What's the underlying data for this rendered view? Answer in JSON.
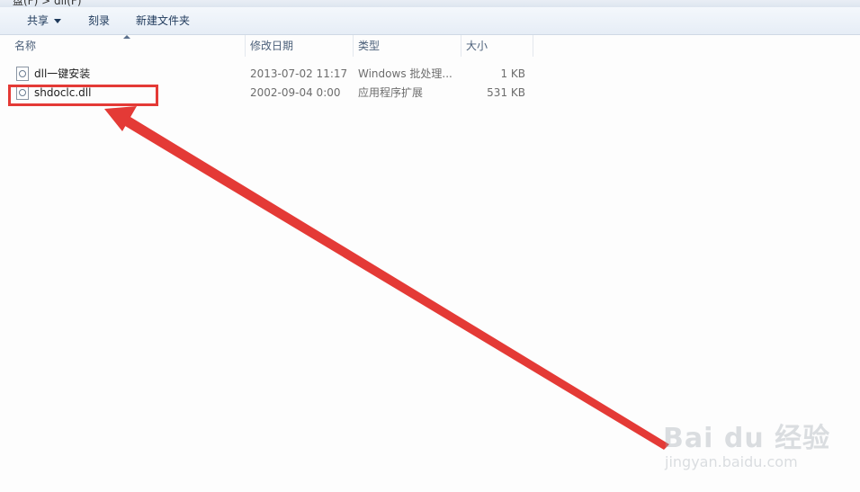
{
  "window": {
    "title_fragment": "盘(F) > dll(F)"
  },
  "toolbar": {
    "share_label": "共享",
    "burn_label": "刻录",
    "new_folder_label": "新建文件夹"
  },
  "columns": {
    "name": "名称",
    "date": "修改日期",
    "type": "类型",
    "size": "大小"
  },
  "files": [
    {
      "name": "dll一键安装",
      "date": "2013-07-02 11:17",
      "type": "Windows 批处理...",
      "size": "1 KB",
      "icon": "batch-file-icon"
    },
    {
      "name": "shdoclc.dll",
      "date": "2002-09-04 0:00",
      "type": "应用程序扩展",
      "size": "531 KB",
      "icon": "dll-file-icon"
    }
  ],
  "annotation": {
    "color": "#e43a36"
  },
  "watermark": {
    "brand": "Bai du",
    "brand_cn": "经验",
    "url": "jingyan.baidu.com"
  }
}
